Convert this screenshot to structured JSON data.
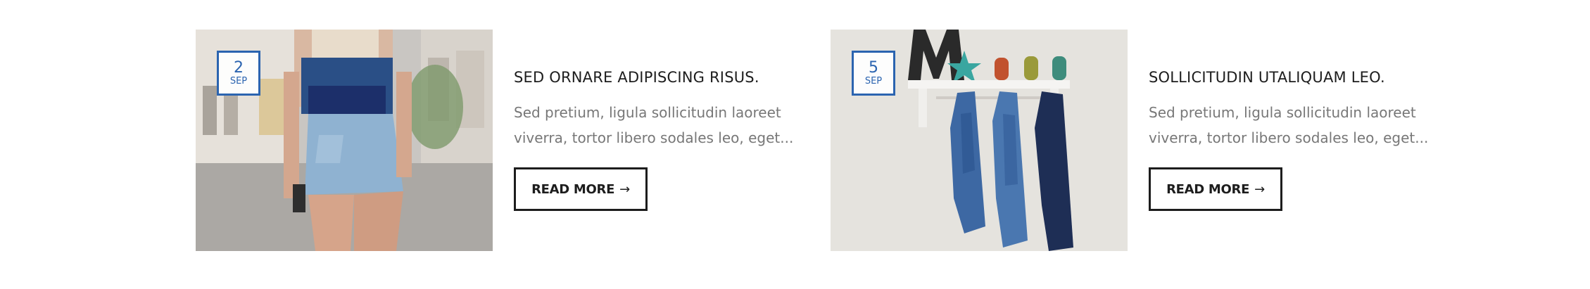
{
  "posts": [
    {
      "date": {
        "day": "2",
        "month": "SEP"
      },
      "title": "SED ORNARE ADIPISCING RISUS.",
      "excerpt": "Sed pretium, ligula sollicitudin laoreet viverra, tortor libero sodales leo, eget...",
      "read_more": "READ MORE",
      "arrow": "→"
    },
    {
      "date": {
        "day": "5",
        "month": "SEP"
      },
      "title": "SOLLICITUDIN UTALIQUAM LEO.",
      "excerpt": "Sed pretium, ligula sollicitudin laoreet viverra, tortor libero sodales leo, eget...",
      "read_more": "READ MORE",
      "arrow": "→"
    }
  ],
  "colors": {
    "accent": "#2b64b0",
    "title": "#1d1d1d",
    "excerpt": "#777777"
  }
}
